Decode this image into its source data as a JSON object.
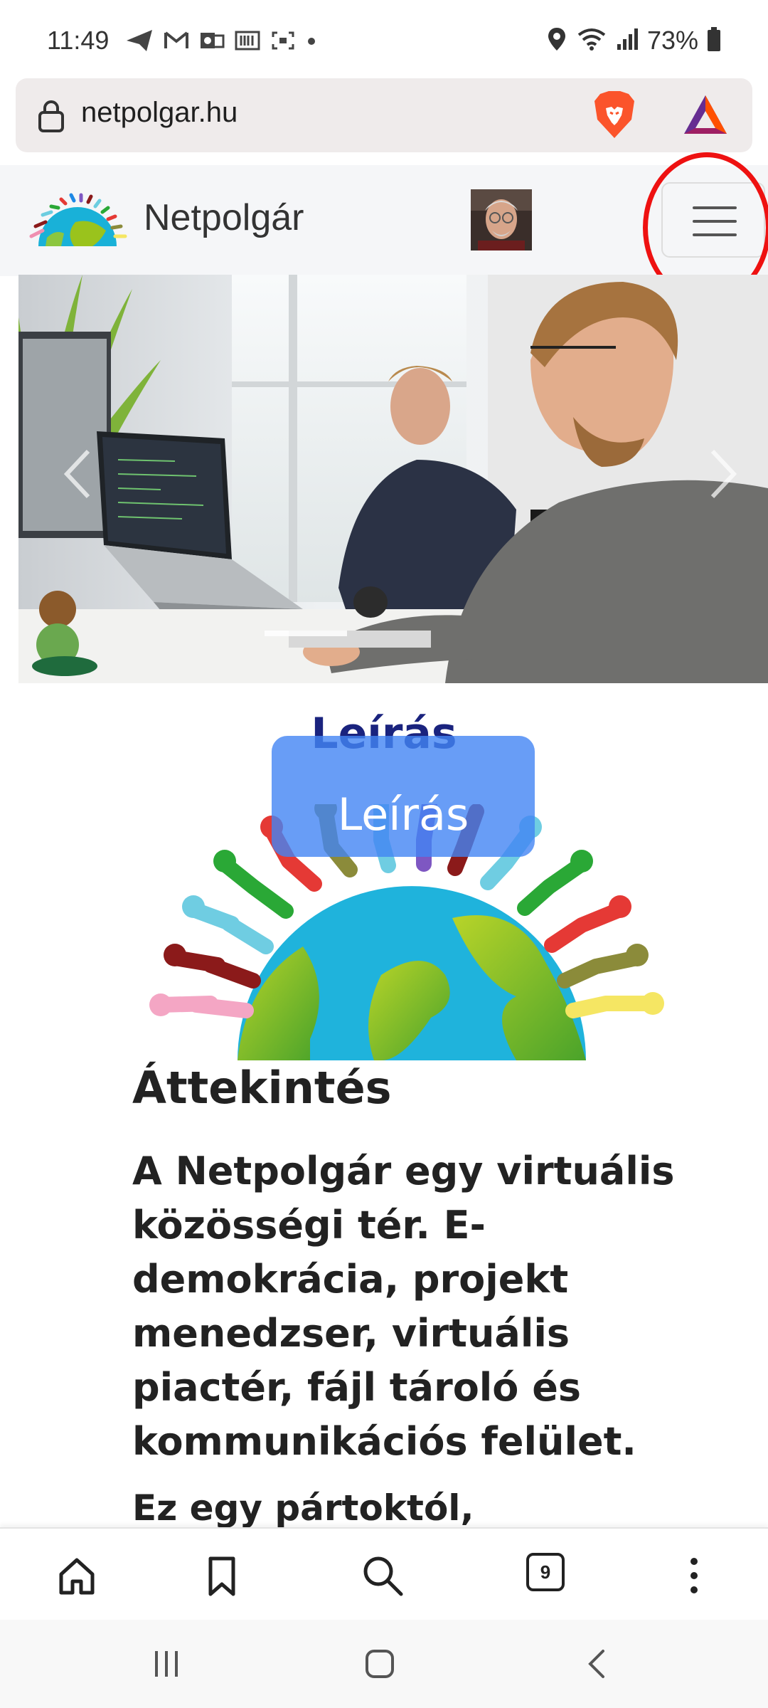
{
  "status_bar": {
    "time": "11:49",
    "battery": "73%"
  },
  "url_bar": {
    "url": "netpolgar.hu"
  },
  "site_nav": {
    "brand": "Netpolgár"
  },
  "hero": {
    "leiras_title": "Leírás",
    "leiras_button": "Leírás"
  },
  "content": {
    "overview_heading": "Áttekintés",
    "lead_paragraph": "A Netpolgár egy virtuális közösségi tér. E-demokrácia, projekt menedzser, virtuális piactér, fájl tároló és kommunikációs felület.",
    "second_paragraph": "Ez egy pártoktól,"
  },
  "browser_toolbar": {
    "tabs_count": "9"
  },
  "colors": {
    "highlight_circle": "#ee1111",
    "button_blue": "#4285f4",
    "brave_orange": "#fb542b"
  }
}
